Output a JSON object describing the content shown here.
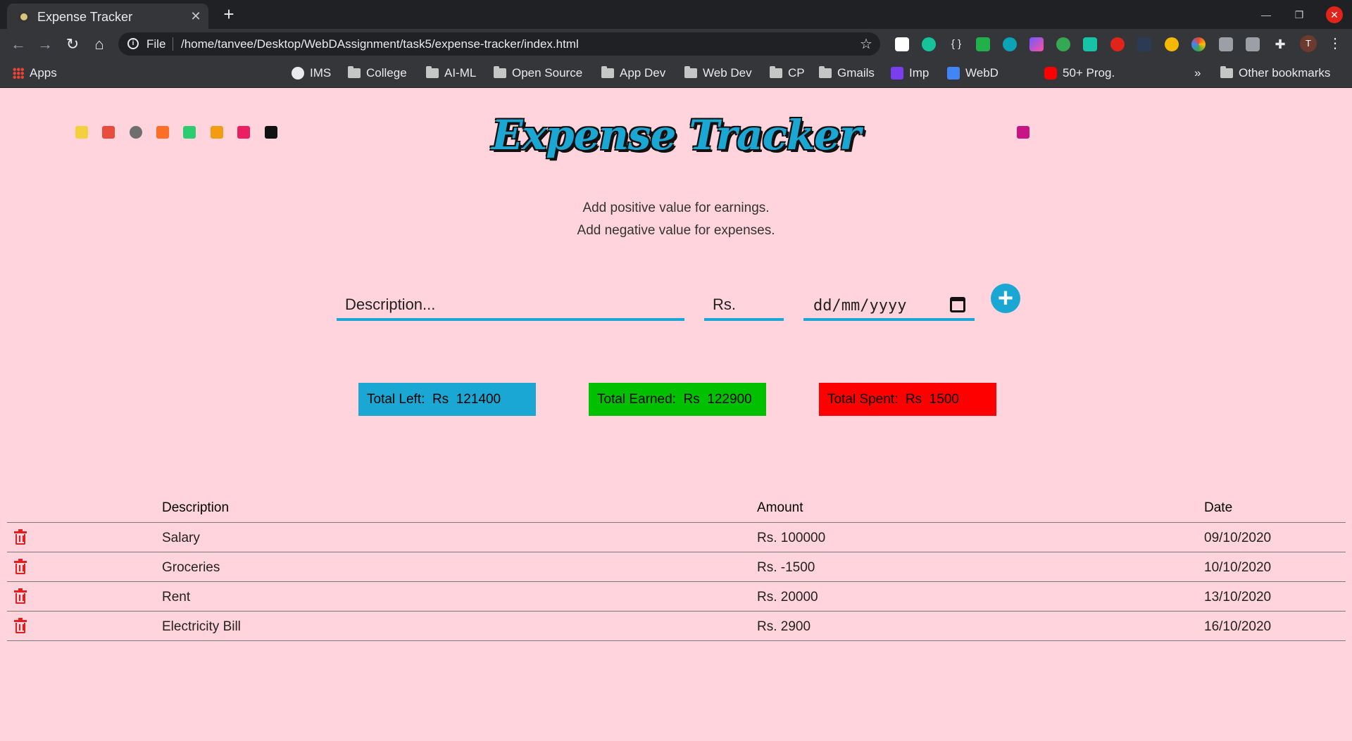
{
  "browser": {
    "tab_title": "Expense Tracker",
    "scheme": "File",
    "url": "/home/tanvee/Desktop/WebDAssignment/task5/expense-tracker/index.html",
    "profile_initial": "T",
    "bookmarks": [
      {
        "label": "Apps",
        "icon": "apps-icon"
      },
      {
        "label": "IMS",
        "icon": "globe-icon"
      },
      {
        "label": "College",
        "icon": "folder-icon"
      },
      {
        "label": "AI-ML",
        "icon": "folder-icon"
      },
      {
        "label": "Open Source",
        "icon": "folder-icon"
      },
      {
        "label": "App Dev",
        "icon": "folder-icon"
      },
      {
        "label": "Web Dev",
        "icon": "folder-icon"
      },
      {
        "label": "CP",
        "icon": "folder-icon"
      },
      {
        "label": "Gmails",
        "icon": "folder-icon"
      },
      {
        "label": "Imp",
        "icon": "site-icon"
      },
      {
        "label": "WebD",
        "icon": "docs-icon"
      },
      {
        "label": "50+ Prog.",
        "icon": "youtube-icon"
      },
      {
        "label": "Other bookmarks",
        "icon": "folder-icon"
      }
    ],
    "overflow": "»"
  },
  "page": {
    "title": "Expense Tracker",
    "hint_line1": "Add positive value for earnings.",
    "hint_line2": "Add negative value for expenses.",
    "form": {
      "description_placeholder": "Description...",
      "amount_placeholder": "Rs.",
      "date_placeholder": "dd/mm/yyyy"
    },
    "summary": {
      "left": "Total Left:  Rs  121400",
      "earned": "Total Earned:  Rs  122900",
      "spent": "Total Spent:  Rs  1500"
    },
    "colors": {
      "accent": "#1aa7d4",
      "earned": "#00c000",
      "spent": "#ff0000",
      "background": "#ffd4dc"
    },
    "table": {
      "headers": {
        "description": "Description",
        "amount": "Amount",
        "date": "Date"
      },
      "rows": [
        {
          "description": "Salary",
          "amount": "Rs. 100000",
          "date": "09/10/2020"
        },
        {
          "description": "Groceries",
          "amount": "Rs. -1500",
          "date": "10/10/2020"
        },
        {
          "description": "Rent",
          "amount": "Rs. 20000",
          "date": "13/10/2020"
        },
        {
          "description": "Electricity Bill",
          "amount": "Rs. 2900",
          "date": "16/10/2020"
        }
      ]
    }
  }
}
